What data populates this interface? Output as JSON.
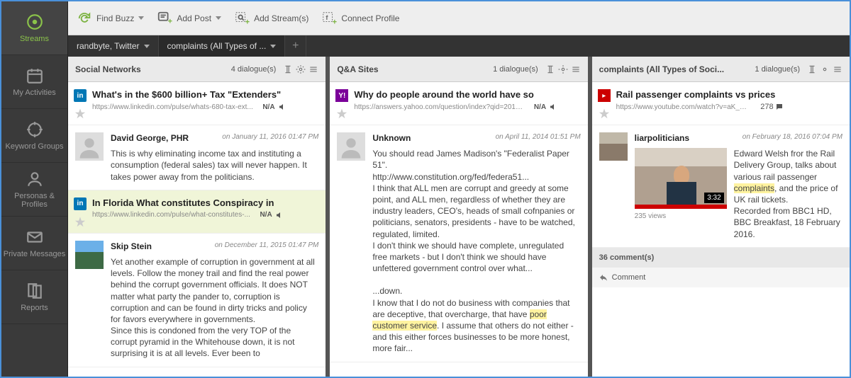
{
  "sidebar": [
    {
      "id": "streams",
      "label": "Streams"
    },
    {
      "id": "activities",
      "label": "My Activities"
    },
    {
      "id": "keywords",
      "label": "Keyword Groups"
    },
    {
      "id": "personas",
      "label": "Personas & Profiles"
    },
    {
      "id": "messages",
      "label": "Private Messages"
    },
    {
      "id": "reports",
      "label": "Reports"
    }
  ],
  "toolbar": {
    "find": "Find Buzz",
    "add_post": "Add Post",
    "add_stream": "Add Stream(s)",
    "connect": "Connect Profile"
  },
  "tabs": [
    {
      "label": "randbyte, Twitter"
    },
    {
      "label": "complaints (All Types of ..."
    }
  ],
  "columns": [
    {
      "title": "Social Networks",
      "dialogues": "4 dialogue(s)",
      "items": [
        {
          "source": "li",
          "title": "What's in the $600 billion+ Tax \"Extenders\"",
          "url": "https://www.linkedin.com/pulse/whats-680-tax-ext...",
          "sent": "N/A",
          "author": "David George, PHR",
          "ts": "on January 11, 2016 01:47 PM",
          "body": "This is why eliminating income tax and instituting a consumption (federal sales) tax will never happen. It takes power away from the politicians."
        },
        {
          "source": "li",
          "highlight": true,
          "title": "In Florida What constitutes Conspiracy in",
          "url": "https://www.linkedin.com/pulse/what-constitutes-...",
          "sent": "N/A",
          "author": "Skip Stein",
          "ts": "on December 11, 2015 01:47 PM",
          "body": "Yet another example of corruption in government at all levels. Follow the money trail and find the real power behind the corrupt government officials. It does NOT matter what party the pander to, corruption is corruption and can be found in dirty tricks and policy for favors everywhere in governments.\nSince this is condoned from the very TOP of the corrupt pyramid in the Whitehouse down, it is not surprising it is at all levels. Ever been to"
        }
      ]
    },
    {
      "title": "Q&A Sites",
      "dialogues": "1 dialogue(s)",
      "items": [
        {
          "source": "ya",
          "title": "Why do people around the world have so",
          "url": "https://answers.yahoo.com/question/index?qid=2013...",
          "sent": "N/A",
          "author": "Unknown",
          "ts": "on April 11, 2014 01:51 PM",
          "body": "You should read James Madison's \"Federalist Paper 51\".\nhttp://www.constitution.org/fed/federa51...\nI think that ALL men are corrupt and greedy at some point, and ALL men, regardless of whether they are industry leaders, CEO's, heads of small cofnpanies or politicians, senators, presidents - have to be watched, regulated, limited.\nI don't think we should have complete, unregulated free markets - but I don't think we should have unfettered government control over what...\n\n...down.\nI know that I do not do business with companies that are deceptive, that overcharge, that have ",
          "body_hl": "poor customer service",
          "body2": ". I assume that others do not either - and this either forces businesses to be more honest, more fair..."
        }
      ]
    },
    {
      "title": "complaints (All Types of Soci...",
      "dialogues": "1 dialogue(s)",
      "items": [
        {
          "source": "yt",
          "title": "Rail passenger complaints vs prices",
          "url": "https://www.youtube.com/watch?v=aK_ZzD...",
          "stat": "278",
          "author": "liarpoliticians",
          "ts": "on February 18, 2016 07:04 PM",
          "dur": "3:32",
          "views": "235 views",
          "body": "Edward Welsh fror the Rail Delivery Group, talks about various rail passenger ",
          "body_hl": "complaints",
          "body2": ", and the price of UK rail tickets.\nRecorded from BBC1 HD, BBC Breakfast, 18 February 2016.",
          "comments": "36 comment(s)",
          "comment_action": "Comment"
        }
      ]
    }
  ]
}
